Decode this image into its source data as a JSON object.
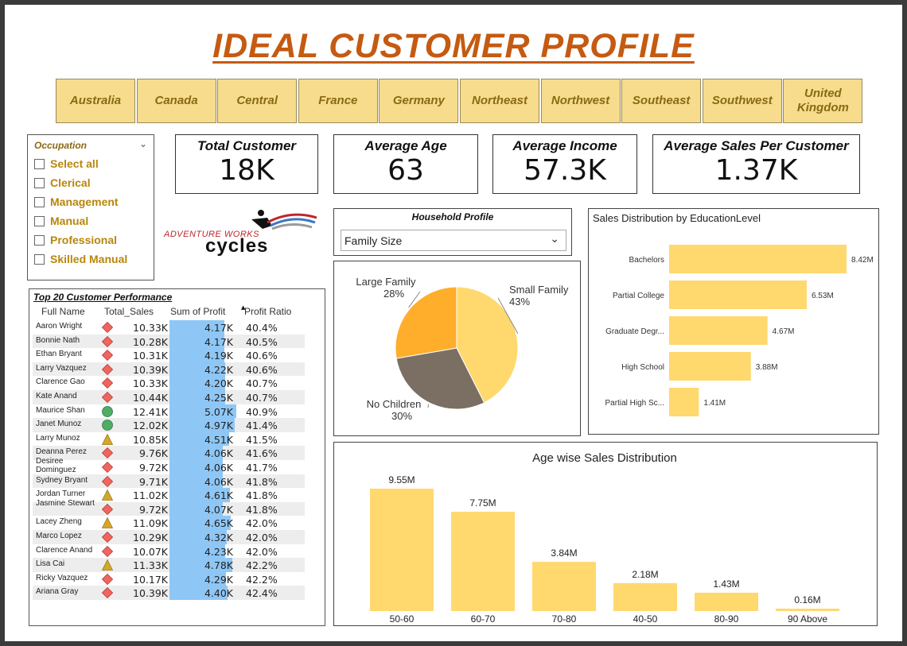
{
  "title": "IDEAL CUSTOMER PROFILE",
  "regions": [
    "Australia",
    "Canada",
    "Central",
    "France",
    "Germany",
    "Northeast",
    "Northwest",
    "Southeast",
    "Southwest",
    "United Kingdom"
  ],
  "occupation": {
    "title": "Occupation",
    "items": [
      "Select all",
      "Clerical",
      "Management",
      "Manual",
      "Professional",
      "Skilled Manual"
    ]
  },
  "kpis": [
    {
      "label": "Total Customer",
      "value": "18K"
    },
    {
      "label": "Average Age",
      "value": "63"
    },
    {
      "label": "Average Income",
      "value": "57.3K"
    },
    {
      "label": "Average Sales Per Customer",
      "value": "1.37K"
    }
  ],
  "logo": {
    "line1": "ADVENTURE WORKS",
    "line2": "cycles"
  },
  "household": {
    "title": "Household Profile",
    "selected": "Family Size"
  },
  "table": {
    "title": "Top 20 Customer Performance",
    "headers": [
      "Full Name",
      "Total_Sales",
      "Sum of Profit",
      "Profit Ratio"
    ],
    "rows": [
      {
        "name": "Aaron Wright",
        "icon": "diamond-red",
        "sales": "10.33K",
        "profit": "4.17K",
        "profit_value": 4.17,
        "ratio": "40.4%"
      },
      {
        "name": "Bonnie Nath",
        "icon": "diamond-red",
        "sales": "10.28K",
        "profit": "4.17K",
        "profit_value": 4.17,
        "ratio": "40.5%"
      },
      {
        "name": "Ethan Bryant",
        "icon": "diamond-red",
        "sales": "10.31K",
        "profit": "4.19K",
        "profit_value": 4.19,
        "ratio": "40.6%"
      },
      {
        "name": "Larry Vazquez",
        "icon": "diamond-red",
        "sales": "10.39K",
        "profit": "4.22K",
        "profit_value": 4.22,
        "ratio": "40.6%"
      },
      {
        "name": "Clarence Gao",
        "icon": "diamond-red",
        "sales": "10.33K",
        "profit": "4.20K",
        "profit_value": 4.2,
        "ratio": "40.7%"
      },
      {
        "name": "Kate Anand",
        "icon": "diamond-red",
        "sales": "10.44K",
        "profit": "4.25K",
        "profit_value": 4.25,
        "ratio": "40.7%"
      },
      {
        "name": "Maurice Shan",
        "icon": "circle-green",
        "sales": "12.41K",
        "profit": "5.07K",
        "profit_value": 5.07,
        "ratio": "40.9%"
      },
      {
        "name": "Janet Munoz",
        "icon": "circle-green",
        "sales": "12.02K",
        "profit": "4.97K",
        "profit_value": 4.97,
        "ratio": "41.4%"
      },
      {
        "name": "Larry Munoz",
        "icon": "triangle-yellow",
        "sales": "10.85K",
        "profit": "4.51K",
        "profit_value": 4.51,
        "ratio": "41.5%"
      },
      {
        "name": "Deanna Perez",
        "icon": "diamond-red",
        "sales": "9.76K",
        "profit": "4.06K",
        "profit_value": 4.06,
        "ratio": "41.6%"
      },
      {
        "name": "Desiree Dominguez",
        "icon": "diamond-red",
        "sales": "9.72K",
        "profit": "4.06K",
        "profit_value": 4.06,
        "ratio": "41.7%"
      },
      {
        "name": "Sydney Bryant",
        "icon": "diamond-red",
        "sales": "9.71K",
        "profit": "4.06K",
        "profit_value": 4.06,
        "ratio": "41.8%"
      },
      {
        "name": "Jordan Turner",
        "icon": "triangle-yellow",
        "sales": "11.02K",
        "profit": "4.61K",
        "profit_value": 4.61,
        "ratio": "41.8%"
      },
      {
        "name": "Jasmine Stewart",
        "icon": "diamond-red",
        "sales": "9.72K",
        "profit": "4.07K",
        "profit_value": 4.07,
        "ratio": "41.8%"
      },
      {
        "name": "Lacey Zheng",
        "icon": "triangle-yellow",
        "sales": "11.09K",
        "profit": "4.65K",
        "profit_value": 4.65,
        "ratio": "42.0%"
      },
      {
        "name": "Marco Lopez",
        "icon": "diamond-red",
        "sales": "10.29K",
        "profit": "4.32K",
        "profit_value": 4.32,
        "ratio": "42.0%"
      },
      {
        "name": "Clarence Anand",
        "icon": "diamond-red",
        "sales": "10.07K",
        "profit": "4.23K",
        "profit_value": 4.23,
        "ratio": "42.0%"
      },
      {
        "name": "Lisa Cai",
        "icon": "triangle-yellow",
        "sales": "11.33K",
        "profit": "4.78K",
        "profit_value": 4.78,
        "ratio": "42.2%"
      },
      {
        "name": "Ricky Vazquez",
        "icon": "diamond-red",
        "sales": "10.17K",
        "profit": "4.29K",
        "profit_value": 4.29,
        "ratio": "42.2%"
      },
      {
        "name": "Ariana Gray",
        "icon": "diamond-red",
        "sales": "10.39K",
        "profit": "4.40K",
        "profit_value": 4.4,
        "ratio": "42.4%"
      }
    ]
  },
  "colors": {
    "accent": "#c55a11",
    "region_fill": "#f6dc8c",
    "bar_yellow": "#ffd86e",
    "profit_bar": "#8ec7f6",
    "pie_small": "#ffd86e",
    "pie_none": "#7a6f62",
    "pie_large": "#ffae2b",
    "diamond_red": "#f0665e",
    "circle_green": "#4fad65",
    "triangle_yellow": "#d4a62a"
  },
  "chart_data": [
    {
      "type": "pie",
      "title": "",
      "slices": [
        {
          "label": "Small Family",
          "value": 43,
          "display": "43%"
        },
        {
          "label": "No Children",
          "value": 30,
          "display": "30%"
        },
        {
          "label": "Large Family",
          "value": 28,
          "display": "28%"
        }
      ]
    },
    {
      "type": "bar",
      "orientation": "horizontal",
      "title": "Sales Distribution by EducationLevel",
      "categories": [
        "Bachelors",
        "Partial College",
        "Graduate Degr...",
        "High School",
        "Partial High Sc..."
      ],
      "values": [
        8.42,
        6.53,
        4.67,
        3.88,
        1.41
      ],
      "labels": [
        "8.42M",
        "6.53M",
        "4.67M",
        "3.88M",
        "1.41M"
      ],
      "unit": "M",
      "xlim": [
        0,
        8.42
      ]
    },
    {
      "type": "bar",
      "orientation": "vertical",
      "title": "Age wise Sales Distribution",
      "categories": [
        "50-60",
        "60-70",
        "70-80",
        "40-50",
        "80-90",
        "90 Above"
      ],
      "values": [
        9.55,
        7.75,
        3.84,
        2.18,
        1.43,
        0.16
      ],
      "labels": [
        "9.55M",
        "7.75M",
        "3.84M",
        "2.18M",
        "1.43M",
        "0.16M"
      ],
      "unit": "M",
      "ylim": [
        0,
        9.55
      ]
    }
  ]
}
